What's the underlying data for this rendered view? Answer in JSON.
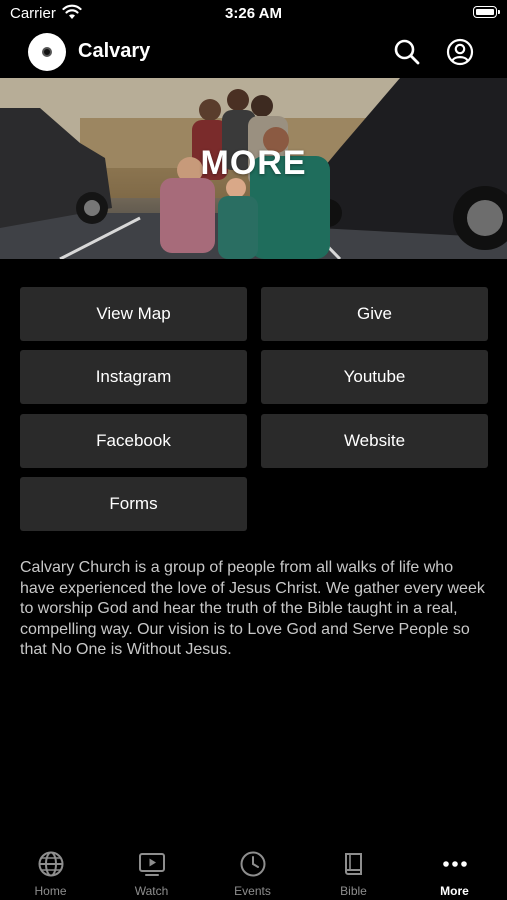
{
  "status_bar": {
    "carrier": "Carrier",
    "time": "3:26 AM",
    "wifi_icon": "wifi-icon",
    "battery_icon": "battery-icon"
  },
  "header": {
    "app_name": "Calvary",
    "logo_icon": "calvary-logo",
    "search_icon": "search-icon",
    "profile_icon": "profile-icon"
  },
  "hero": {
    "title": "MORE"
  },
  "buttons": [
    {
      "label": "View Map"
    },
    {
      "label": "Give"
    },
    {
      "label": "Instagram"
    },
    {
      "label": "Youtube"
    },
    {
      "label": "Facebook"
    },
    {
      "label": "Website"
    },
    {
      "label": "Forms"
    }
  ],
  "about": {
    "text": "Calvary Church is a group of people from all walks of life who have experienced the love of Jesus Christ. We gather every week to worship God and hear the truth of the Bible taught in a real, compelling way. Our vision is to Love God and Serve People so that No One is Without Jesus."
  },
  "tab_bar": {
    "tabs": [
      {
        "label": "Home",
        "icon": "globe-icon"
      },
      {
        "label": "Watch",
        "icon": "tv-play-icon"
      },
      {
        "label": "Events",
        "icon": "clock-icon"
      },
      {
        "label": "Bible",
        "icon": "book-icon"
      },
      {
        "label": "More",
        "icon": "more-dots-icon"
      }
    ],
    "active": "More"
  },
  "colors": {
    "background": "#000000",
    "button_bg": "#2a2a2a",
    "body_text": "#c8c8c8",
    "tab_inactive": "#8e8e8e",
    "tab_active": "#ffffff"
  }
}
